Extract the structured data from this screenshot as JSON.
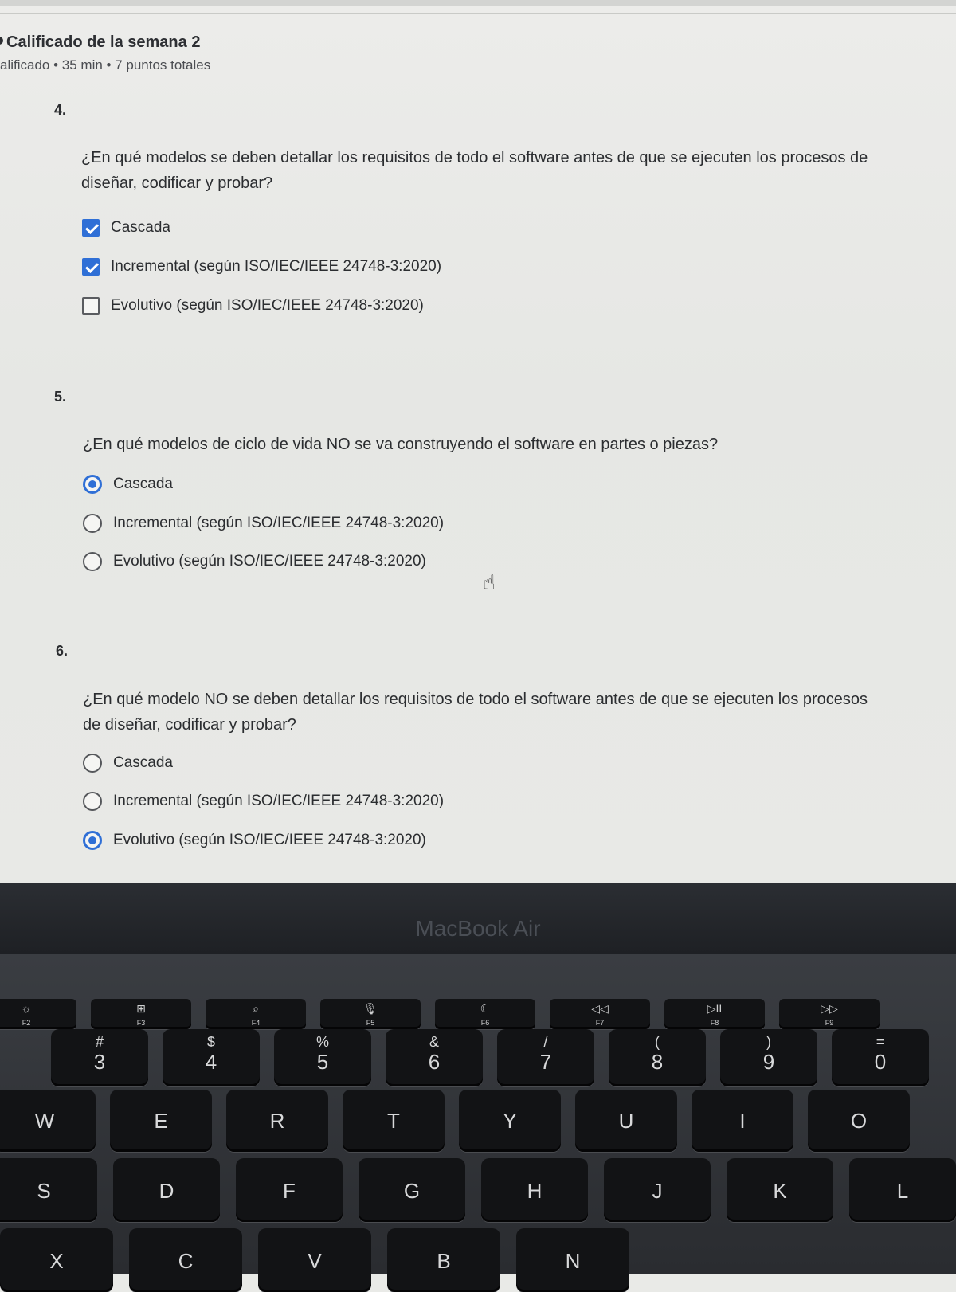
{
  "header": {
    "title": "Calificado de la semana 2",
    "meta": "alificado • 35 min • 7 puntos totales"
  },
  "questions": [
    {
      "number": "4.",
      "text": "¿En qué modelos se deben detallar los requisitos de todo el software antes de que se ejecuten los procesos de diseñar, codificar y probar?",
      "type": "checkbox",
      "options": [
        {
          "label": "Cascada",
          "checked": true
        },
        {
          "label": "Incremental (según ISO/IEC/IEEE 24748-3:2020)",
          "checked": true
        },
        {
          "label": "Evolutivo (según ISO/IEC/IEEE 24748-3:2020)",
          "checked": false
        }
      ]
    },
    {
      "number": "5.",
      "text": "¿En qué modelos de ciclo de vida NO se va construyendo el software en partes o piezas?",
      "type": "radio",
      "options": [
        {
          "label": "Cascada",
          "checked": true
        },
        {
          "label": "Incremental (según ISO/IEC/IEEE 24748-3:2020)",
          "checked": false
        },
        {
          "label": "Evolutivo (según ISO/IEC/IEEE 24748-3:2020)",
          "checked": false
        }
      ]
    },
    {
      "number": "6.",
      "text": "¿En qué modelo NO se deben detallar los requisitos de todo el software antes de que se ejecuten los procesos de diseñar, codificar y probar?",
      "type": "radio",
      "options": [
        {
          "label": "Cascada",
          "checked": false
        },
        {
          "label": "Incremental (según ISO/IEC/IEEE 24748-3:2020)",
          "checked": false
        },
        {
          "label": "Evolutivo (según ISO/IEC/IEEE 24748-3:2020)",
          "checked": true
        }
      ]
    }
  ],
  "device": {
    "brand": "MacBook Air"
  },
  "keyboard": {
    "fn_row": [
      {
        "sym": "☼",
        "label": "F2"
      },
      {
        "sym": "⊞",
        "label": "F3"
      },
      {
        "sym": "⌕",
        "label": "F4"
      },
      {
        "sym": "🎙",
        "label": "F5"
      },
      {
        "sym": "☾",
        "label": "F6"
      },
      {
        "sym": "◁◁",
        "label": "F7"
      },
      {
        "sym": "▷II",
        "label": "F8"
      },
      {
        "sym": "▷▷",
        "label": "F9"
      }
    ],
    "number_row": [
      {
        "top": "#",
        "main": "3"
      },
      {
        "top": "$",
        "main": "4"
      },
      {
        "top": "%",
        "main": "5"
      },
      {
        "top": "&",
        "main": "6"
      },
      {
        "top": "/",
        "main": "7"
      },
      {
        "top": "(",
        "main": "8"
      },
      {
        "top": ")",
        "main": "9"
      },
      {
        "top": "=",
        "main": "0"
      }
    ],
    "row_q": [
      "W",
      "E",
      "R",
      "T",
      "Y",
      "U",
      "I",
      "O"
    ],
    "row_a": [
      "S",
      "D",
      "F",
      "G",
      "H",
      "J",
      "K",
      "L"
    ],
    "row_z": [
      "X",
      "C",
      "V",
      "B",
      "N"
    ],
    "colors": {
      "key": "#121315",
      "deck": "#2f3236",
      "accent": "#2f6fd6"
    }
  }
}
